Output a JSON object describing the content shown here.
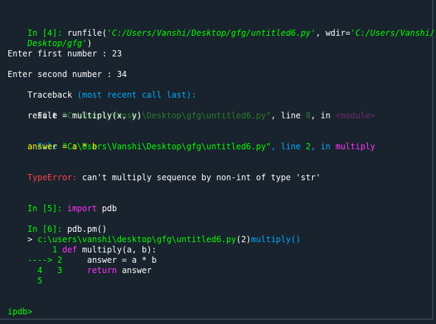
{
  "in4": {
    "prompt": "In [4]:",
    "call": " runfile(",
    "path_str": "'C:/Users/Vanshi/Desktop/gfg/untitled6.py'",
    "wdir_kw": ", wdir=",
    "wdir_str_1": "'C:/Users/Vanshi/",
    "wdir_str_2": "Desktop/gfg'",
    "close": ")"
  },
  "out": {
    "first_prompt": "Enter first number : 23",
    "second_prompt": "Enter second number : 34",
    "traceback_label": "Traceback ",
    "traceback_detail": "(most recent call last):",
    "frame1_file_kw": "  File ",
    "frame1_path": "\"C:\\Users\\Vanshi\\Desktop\\gfg\\untitled6.py\"",
    "frame1_line_kw": ", line ",
    "frame1_line_no": "8",
    "frame1_in_kw": ", in ",
    "frame1_module": "<module>",
    "frame1_code": "    result = multiply(x, y)",
    "frame2_file_kw": "  File ",
    "frame2_path": "\"C:\\Users\\Vanshi\\Desktop\\gfg\\untitled6.py\"",
    "frame2_line_kw": ", line ",
    "frame2_line_no": "2",
    "frame2_in_kw": ", in ",
    "frame2_func": "multiply",
    "frame2_code": "    answer = a * b",
    "error_type": "TypeError:",
    "error_msg": " can't multiply sequence by non-int of type 'str'"
  },
  "in5": {
    "prompt": "In [5]:",
    "keyword": " import",
    "module": " pdb"
  },
  "in6": {
    "prompt": "In [6]:",
    "code": " pdb.pm()"
  },
  "pdb": {
    "location_arrow": "> ",
    "location_path": "c:\\users\\vanshi\\desktop\\gfg\\untitled6.py",
    "location_line": "(2)",
    "location_func": "multiply()",
    "src1_no": "     1 ",
    "src1_kw": "def",
    "src1_rest": " multiply(a, b):",
    "src2_arrow": "----> 2",
    "src2_code": "     answer = a * b",
    "src3_no": "      3",
    "src3_kw": "     return",
    "src3_rest": " answer",
    "src4_no": "      4",
    "src5_no": "      5",
    "prompt": "ipdb>"
  },
  "colors": {
    "background": "#19232d",
    "prompt_green": "#00ff00",
    "keyword_magenta": "#ff33ff",
    "info_cyan": "#00aaff",
    "error_red": "#ff4444"
  }
}
